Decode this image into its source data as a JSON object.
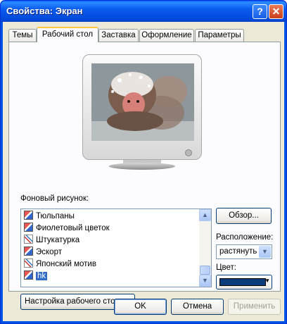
{
  "window": {
    "title": "Свойства: Экран",
    "help_glyph": "?",
    "close_glyph": "✕"
  },
  "tabs": [
    {
      "label": "Темы"
    },
    {
      "label": "Рабочий стол"
    },
    {
      "label": "Заставка"
    },
    {
      "label": "Оформление"
    },
    {
      "label": "Параметры"
    }
  ],
  "active_tab": "Рабочий стол",
  "background": {
    "label": "Фоновый рисунок:",
    "items": [
      {
        "label": "Тюльпаны",
        "icon": "picture-icon"
      },
      {
        "label": "Фиолетовый цветок",
        "icon": "picture-icon"
      },
      {
        "label": "Штукатурка",
        "icon": "paint-brush-icon"
      },
      {
        "label": "Эскорт",
        "icon": "picture-icon"
      },
      {
        "label": "Японский мотив",
        "icon": "paint-brush-icon"
      },
      {
        "label": "hk",
        "icon": "picture-icon",
        "selected": true
      }
    ]
  },
  "browse_button": "Обзор...",
  "position": {
    "label": "Расположение:",
    "value": "растянуть"
  },
  "color": {
    "label": "Цвет:",
    "value": "#0a3b7a"
  },
  "customize_button": "Настройка рабочего стола...",
  "footer": {
    "ok": "OK",
    "cancel": "Отмена",
    "apply": "Применить"
  }
}
